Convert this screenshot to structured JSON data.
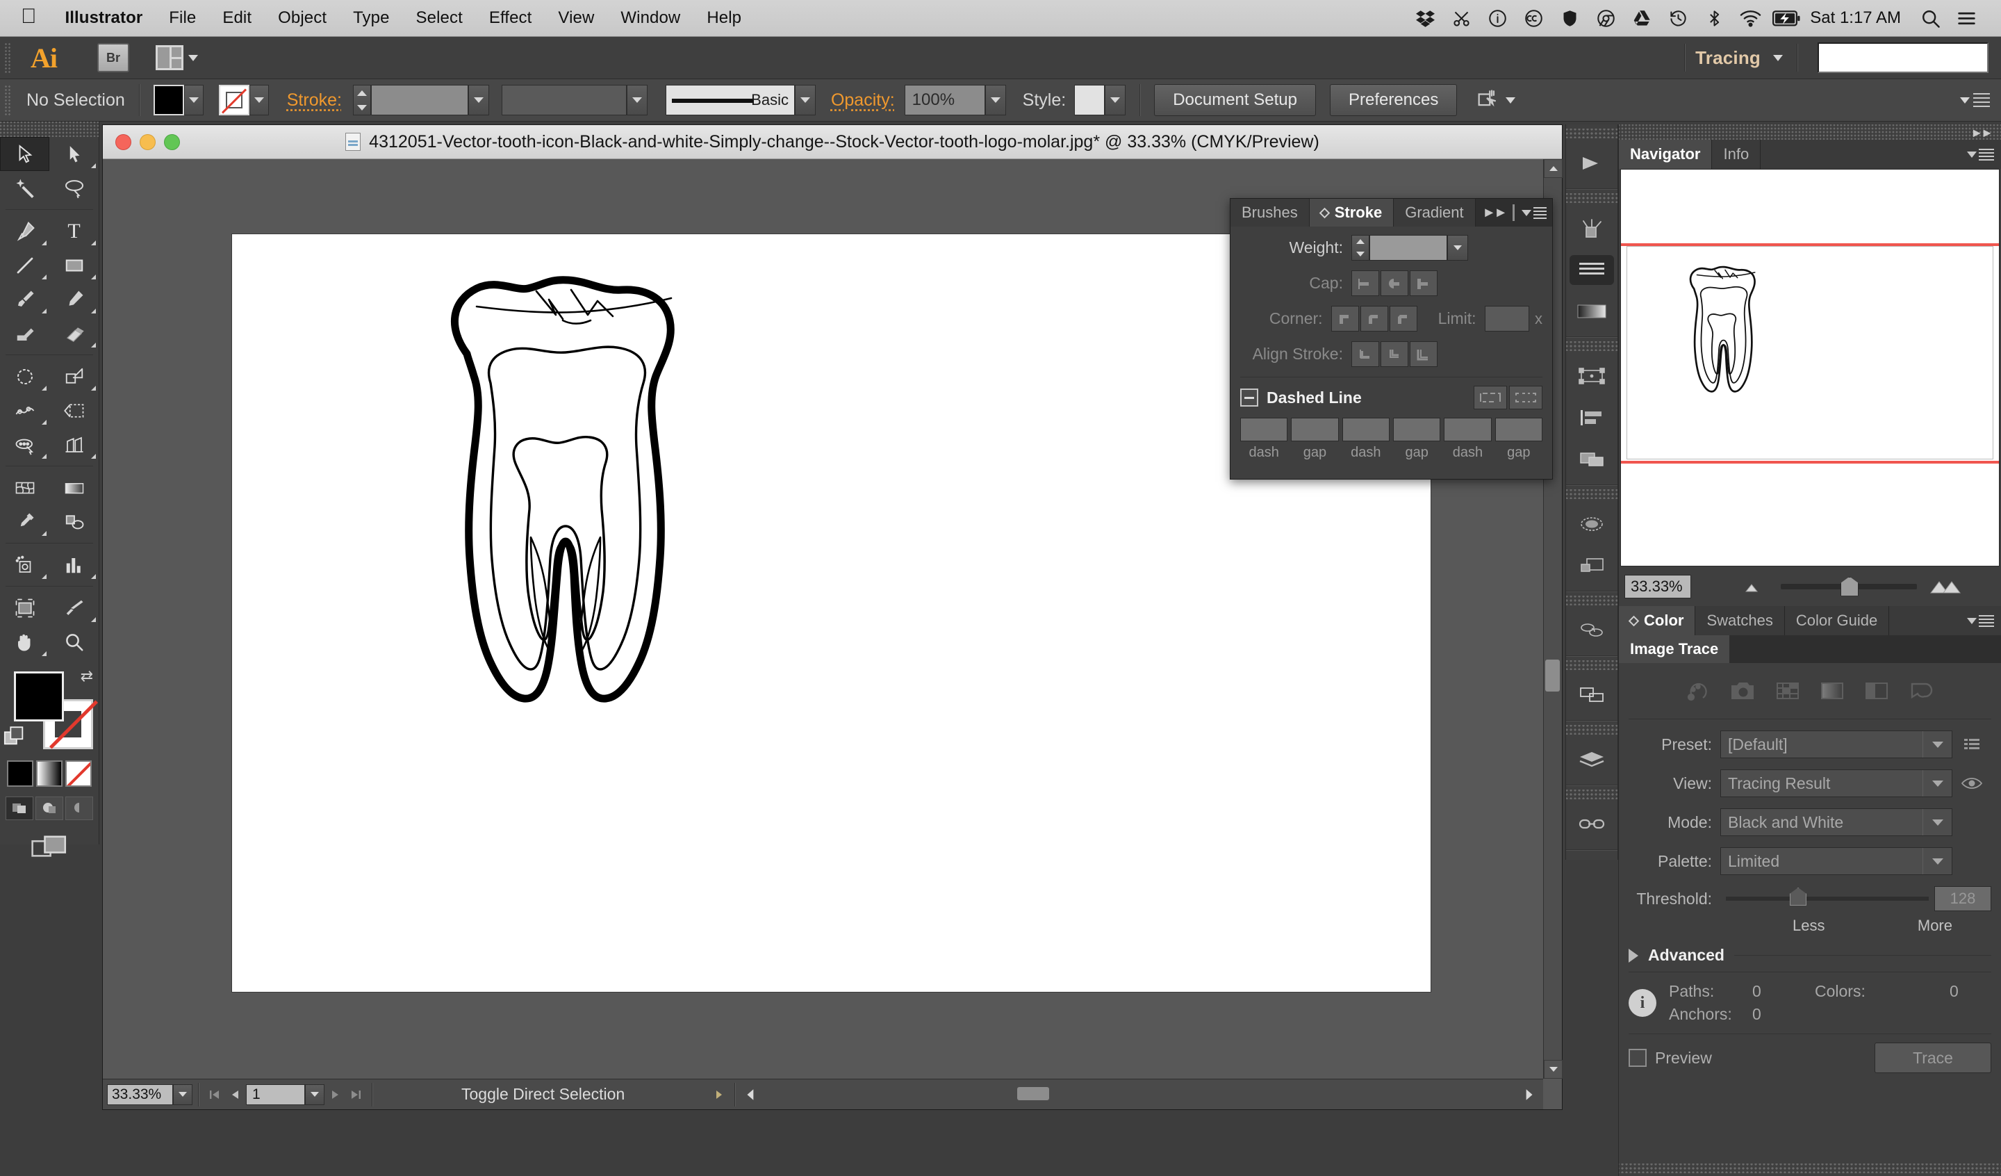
{
  "mac_menubar": {
    "apple_icon": "apple-icon",
    "items": [
      {
        "label": "Illustrator",
        "bold": true
      },
      {
        "label": "File",
        "bold": false
      },
      {
        "label": "Edit",
        "bold": false
      },
      {
        "label": "Object",
        "bold": false
      },
      {
        "label": "Type",
        "bold": false
      },
      {
        "label": "Select",
        "bold": false
      },
      {
        "label": "Effect",
        "bold": false
      },
      {
        "label": "View",
        "bold": false
      },
      {
        "label": "Window",
        "bold": false
      },
      {
        "label": "Help",
        "bold": false
      }
    ],
    "status_icons": [
      "dropbox-icon",
      "scissors-icon",
      "info-circle-icon",
      "cc-circle-icon",
      "shield-icon",
      "chrome-icon",
      "drive-icon",
      "time-machine-icon",
      "bluetooth-icon",
      "wifi-icon",
      "battery-charging-icon"
    ],
    "clock": "Sat 1:17 AM",
    "search_icon": "search-icon",
    "notification_icon": "notification-center-icon"
  },
  "app_bar": {
    "logo": "Ai",
    "bridge_label": "Br",
    "arrange_icon": "arrange-documents-icon",
    "workspace": "Tracing",
    "workspace_caret": "chevron-down-icon",
    "search_value": "",
    "search_placeholder": ""
  },
  "control_bar": {
    "selection_status": "No Selection",
    "fill_swatch_color": "#000000",
    "stroke_swatch": "none",
    "stroke_label": "Stroke:",
    "stroke_weight_value": "",
    "stroke_profile_value": "",
    "brush_definition": "Basic",
    "opacity_label": "Opacity:",
    "opacity_value": "100%",
    "style_label": "Style:",
    "document_setup_label": "Document Setup",
    "preferences_label": "Preferences",
    "transform_icon": "transform-icon"
  },
  "document_window": {
    "title": "4312051-Vector-tooth-icon-Black-and-white-Simply-change--Stock-Vector-tooth-logo-molar.jpg* @ 33.33% (CMYK/Preview)",
    "doc_icon": "document-icon",
    "traffic_lights": [
      "close-button",
      "minimize-button",
      "zoom-button"
    ],
    "artwork": "tooth-molar-line-art",
    "status": {
      "zoom_value": "33.33%",
      "page_value": "1",
      "tool_hint": "Toggle Direct Selection",
      "first_page_icon": "first-page-icon",
      "prev_page_icon": "prev-page-icon",
      "next_page_icon": "next-page-icon",
      "last_page_icon": "last-page-icon"
    }
  },
  "toolbar": {
    "tools": [
      {
        "name": "selection-tool",
        "selected": true,
        "has_flyout": false
      },
      {
        "name": "direct-selection-tool",
        "selected": false,
        "has_flyout": true
      },
      {
        "name": "magic-wand-tool",
        "selected": false,
        "has_flyout": false
      },
      {
        "name": "lasso-tool",
        "selected": false,
        "has_flyout": false
      },
      {
        "name": "pen-tool",
        "selected": false,
        "has_flyout": true
      },
      {
        "name": "type-tool",
        "selected": false,
        "has_flyout": true
      },
      {
        "name": "line-segment-tool",
        "selected": false,
        "has_flyout": true
      },
      {
        "name": "rectangle-tool",
        "selected": false,
        "has_flyout": true
      },
      {
        "name": "paintbrush-tool",
        "selected": false,
        "has_flyout": true
      },
      {
        "name": "pencil-tool",
        "selected": false,
        "has_flyout": true
      },
      {
        "name": "blob-brush-tool",
        "selected": false,
        "has_flyout": false
      },
      {
        "name": "eraser-tool",
        "selected": false,
        "has_flyout": true
      },
      {
        "name": "rotate-tool",
        "selected": false,
        "has_flyout": true
      },
      {
        "name": "scale-tool",
        "selected": false,
        "has_flyout": true
      },
      {
        "name": "width-tool",
        "selected": false,
        "has_flyout": true
      },
      {
        "name": "free-transform-tool",
        "selected": false,
        "has_flyout": false
      },
      {
        "name": "shape-builder-tool",
        "selected": false,
        "has_flyout": true
      },
      {
        "name": "perspective-grid-tool",
        "selected": false,
        "has_flyout": true
      },
      {
        "name": "mesh-tool",
        "selected": false,
        "has_flyout": false
      },
      {
        "name": "gradient-tool",
        "selected": false,
        "has_flyout": false
      },
      {
        "name": "eyedropper-tool",
        "selected": false,
        "has_flyout": true
      },
      {
        "name": "blend-tool",
        "selected": false,
        "has_flyout": false
      },
      {
        "name": "symbol-sprayer-tool",
        "selected": false,
        "has_flyout": true
      },
      {
        "name": "column-graph-tool",
        "selected": false,
        "has_flyout": true
      },
      {
        "name": "artboard-tool",
        "selected": false,
        "has_flyout": false
      },
      {
        "name": "slice-tool",
        "selected": false,
        "has_flyout": true
      },
      {
        "name": "hand-tool",
        "selected": false,
        "has_flyout": true
      },
      {
        "name": "zoom-tool",
        "selected": false,
        "has_flyout": false
      }
    ],
    "fill_color": "#000000",
    "stroke_color": "none",
    "swap_icon": "swap-fill-stroke-icon",
    "default_icon": "default-fill-stroke-icon",
    "color_modes": [
      "color-swatch-mode",
      "gradient-mode",
      "none-mode"
    ],
    "draw_modes": [
      "draw-normal",
      "draw-behind",
      "draw-inside"
    ],
    "screen_mode_icon": "change-screen-mode-icon"
  },
  "stroke_panel": {
    "tabs": [
      {
        "label": "Brushes",
        "active": false
      },
      {
        "label": "Stroke",
        "active": true
      },
      {
        "label": "Gradient",
        "active": false
      }
    ],
    "collapse_icon": "double-chevron-icon",
    "menu_icon": "panel-menu-icon",
    "weight_label": "Weight:",
    "weight_value": "",
    "cap_label": "Cap:",
    "cap_options": [
      "butt-cap",
      "round-cap",
      "projecting-cap"
    ],
    "corner_label": "Corner:",
    "corner_options": [
      "miter-join",
      "round-join",
      "bevel-join"
    ],
    "limit_label": "Limit:",
    "limit_value": "",
    "limit_unit": "x",
    "align_label": "Align Stroke:",
    "align_options": [
      "align-center",
      "align-inside",
      "align-outside"
    ],
    "dashed_line_label": "Dashed Line",
    "dash_buttons": [
      "preserve-exact-dash",
      "align-dashes-to-corners"
    ],
    "dash_fields": [
      {
        "value": "",
        "label": "dash"
      },
      {
        "value": "",
        "label": "gap"
      },
      {
        "value": "",
        "label": "dash"
      },
      {
        "value": "",
        "label": "gap"
      },
      {
        "value": "",
        "label": "dash"
      },
      {
        "value": "",
        "label": "gap"
      }
    ]
  },
  "icon_dock": {
    "groups": [
      [
        "collapse-panels-icon"
      ],
      [
        "brushes-icon",
        "stroke-icon",
        "gradient-icon"
      ],
      [
        "transform-icon",
        "align-icon",
        "pathfinder-icon"
      ],
      [
        "appearance-icon",
        "graphic-styles-icon"
      ],
      [
        "symbols-icon"
      ],
      [
        "artboards-icon"
      ],
      [
        "layers-icon"
      ],
      [
        "links-icon"
      ]
    ]
  },
  "navigator_panel": {
    "tabs": [
      {
        "label": "Navigator",
        "active": true
      },
      {
        "label": "Info",
        "active": false
      }
    ],
    "menu_icon": "panel-menu-icon",
    "collapse_icon": "double-chevron-icon",
    "thumbnail": "tooth-molar-thumbnail",
    "zoom_value": "33.33%",
    "zoom_out_icon": "small-mountains-icon",
    "zoom_in_icon": "large-mountains-icon"
  },
  "color_panel": {
    "tabs": [
      {
        "label": "Color",
        "active": true
      },
      {
        "label": "Swatches",
        "active": false
      },
      {
        "label": "Color Guide",
        "active": false
      }
    ],
    "menu_icon": "panel-menu-icon"
  },
  "image_trace": {
    "tab_label": "Image Trace",
    "preset_icons": [
      "auto-color-icon",
      "high-fidelity-photo-icon",
      "low-fidelity-photo-icon",
      "grayscale-icon",
      "black-and-white-icon",
      "outline-icon"
    ],
    "preset_label": "Preset:",
    "preset_value": "[Default]",
    "preset_manage_icon": "preset-menu-icon",
    "view_label": "View:",
    "view_value": "Tracing Result",
    "view_eye_icon": "eye-icon",
    "mode_label": "Mode:",
    "mode_value": "Black and White",
    "palette_label": "Palette:",
    "palette_value": "Limited",
    "threshold_label": "Threshold:",
    "threshold_value": "128",
    "threshold_less": "Less",
    "threshold_more": "More",
    "advanced_label": "Advanced",
    "advanced_icon": "disclosure-triangle-icon",
    "info_icon": "info-icon",
    "stats": {
      "paths_label": "Paths:",
      "paths_value": "0",
      "colors_label": "Colors:",
      "colors_value": "0",
      "anchors_label": "Anchors:",
      "anchors_value": "0"
    },
    "preview_label": "Preview",
    "preview_checked": false,
    "trace_label": "Trace"
  },
  "colors": {
    "panel_bg": "#3f3f3f",
    "panel_dark": "#2e2e2e",
    "accent_orange": "#f0992e",
    "canvas_gray": "#585858",
    "artboard_white": "#ffffff",
    "nav_red": "#f0564f"
  }
}
